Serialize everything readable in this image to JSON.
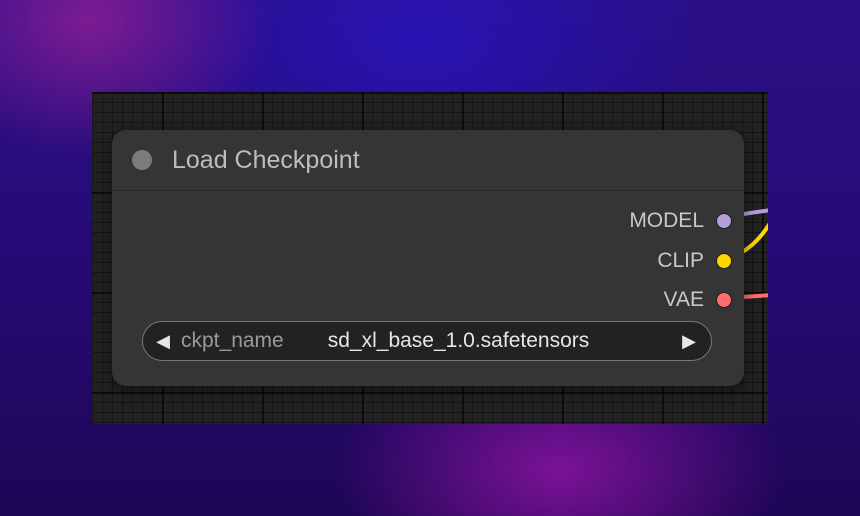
{
  "node": {
    "title": "Load Checkpoint",
    "outputs": [
      {
        "label": "MODEL",
        "color": "#b39ddb"
      },
      {
        "label": "CLIP",
        "color": "#ffd500"
      },
      {
        "label": "VAE",
        "color": "#ff6e6e"
      }
    ],
    "widget": {
      "label": "ckpt_name",
      "value": "sd_xl_base_1.0.safetensors",
      "left_arrow": "◀",
      "right_arrow": "▶"
    }
  }
}
